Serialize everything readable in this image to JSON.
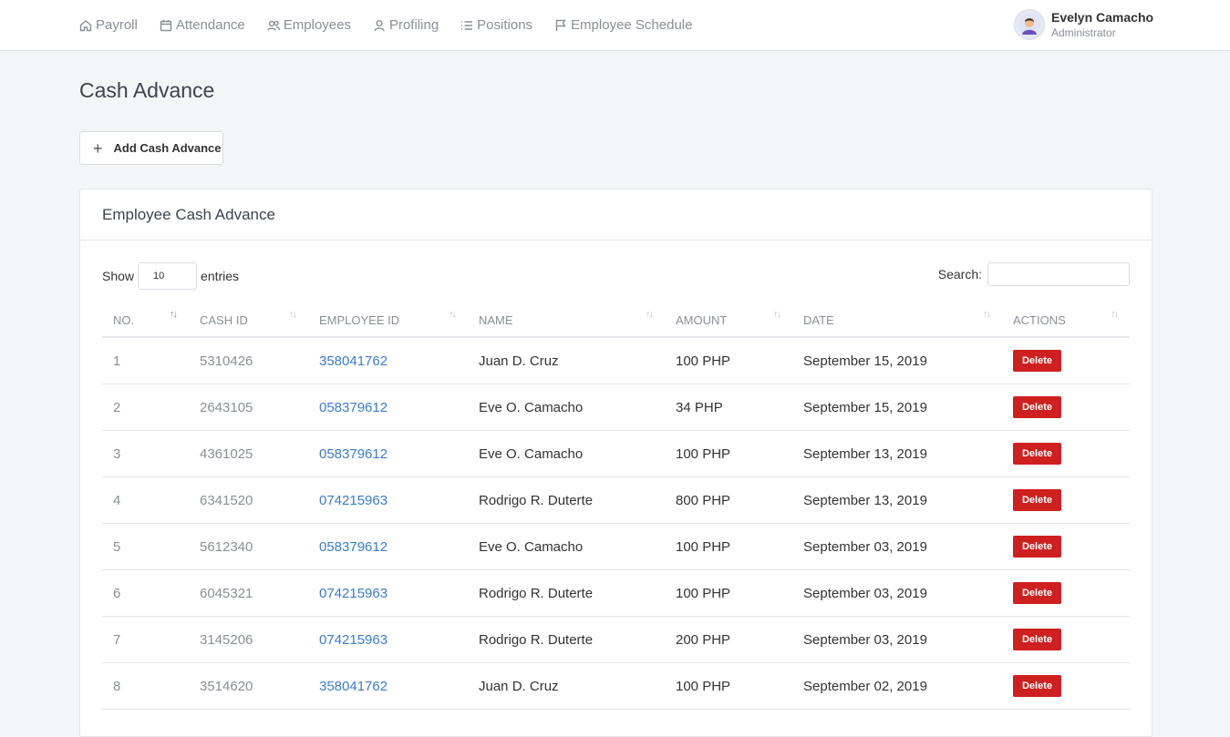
{
  "nav": [
    {
      "label": "Payroll",
      "icon": "home-icon"
    },
    {
      "label": "Attendance",
      "icon": "calendar-icon"
    },
    {
      "label": "Employees",
      "icon": "users-icon"
    },
    {
      "label": "Profiling",
      "icon": "user-icon"
    },
    {
      "label": "Positions",
      "icon": "list-icon"
    },
    {
      "label": "Employee Schedule",
      "icon": "flag-icon"
    }
  ],
  "user": {
    "name": "Evelyn Camacho",
    "role": "Administrator"
  },
  "page_title": "Cash Advance",
  "add_button": "Add Cash Advance",
  "card_title": "Employee Cash Advance",
  "table_controls": {
    "show": "Show",
    "length": "10",
    "entries": "entries",
    "search": "Search:"
  },
  "columns": [
    "NO.",
    "CASH ID",
    "EMPLOYEE ID",
    "NAME",
    "AMOUNT",
    "DATE",
    "ACTIONS"
  ],
  "rows": [
    {
      "no": "1",
      "cash_id": "5310426",
      "employee_id": "358041762",
      "name": "Juan D. Cruz",
      "amount": "100 PHP",
      "date": "September 15, 2019",
      "action": "Delete"
    },
    {
      "no": "2",
      "cash_id": "2643105",
      "employee_id": "058379612",
      "name": "Eve O. Camacho",
      "amount": "34 PHP",
      "date": "September 15, 2019",
      "action": "Delete"
    },
    {
      "no": "3",
      "cash_id": "4361025",
      "employee_id": "058379612",
      "name": "Eve O. Camacho",
      "amount": "100 PHP",
      "date": "September 13, 2019",
      "action": "Delete"
    },
    {
      "no": "4",
      "cash_id": "6341520",
      "employee_id": "074215963",
      "name": "Rodrigo R. Duterte",
      "amount": "800 PHP",
      "date": "September 13, 2019",
      "action": "Delete"
    },
    {
      "no": "5",
      "cash_id": "5612340",
      "employee_id": "058379612",
      "name": "Eve O. Camacho",
      "amount": "100 PHP",
      "date": "September 03, 2019",
      "action": "Delete"
    },
    {
      "no": "6",
      "cash_id": "6045321",
      "employee_id": "074215963",
      "name": "Rodrigo R. Duterte",
      "amount": "100 PHP",
      "date": "September 03, 2019",
      "action": "Delete"
    },
    {
      "no": "7",
      "cash_id": "3145206",
      "employee_id": "074215963",
      "name": "Rodrigo R. Duterte",
      "amount": "200 PHP",
      "date": "September 03, 2019",
      "action": "Delete"
    },
    {
      "no": "8",
      "cash_id": "3514620",
      "employee_id": "358041762",
      "name": "Juan D. Cruz",
      "amount": "100 PHP",
      "date": "September 02, 2019",
      "action": "Delete"
    }
  ],
  "colors": {
    "link": "#3a7bd5",
    "danger": "#cd201f",
    "muted": "#8a8f98"
  }
}
